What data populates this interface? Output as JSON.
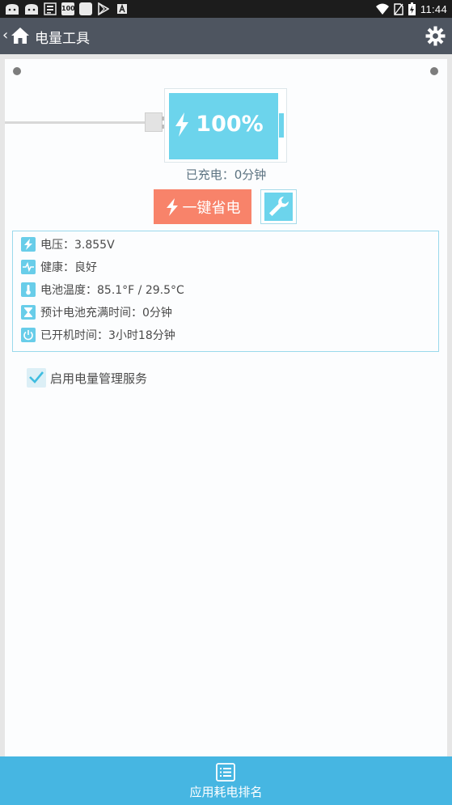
{
  "status_bar": {
    "time": "11:44",
    "icons": [
      "cat-icon",
      "cat-icon",
      "news-icon",
      "100-badge",
      "square-icon",
      "play-store-icon",
      "a-icon"
    ],
    "badge_text": "100",
    "right_icons": [
      "wifi-icon",
      "no-sim-icon",
      "battery-charging-icon"
    ]
  },
  "app_bar": {
    "title": "电量工具",
    "back_icon": "chevron-left-icon",
    "home_icon": "home-icon",
    "settings_icon": "gear-icon"
  },
  "battery": {
    "percent_text": "100%",
    "percent_value": 100,
    "charged_text": "已充电：0分钟"
  },
  "actions": {
    "save_label": "一键省电",
    "tool_icon": "wrench-icon"
  },
  "info": {
    "rows": [
      {
        "icon": "bolt-icon",
        "text": "电压：3.855V"
      },
      {
        "icon": "pulse-icon",
        "text": "健康：良好"
      },
      {
        "icon": "thermometer-icon",
        "text": "电池温度：85.1°F / 29.5°C"
      },
      {
        "icon": "hourglass-icon",
        "text": "预计电池充满时间：0分钟"
      },
      {
        "icon": "power-icon",
        "text": "已开机时间：3小时18分钟"
      }
    ]
  },
  "service": {
    "label": "启用电量管理服务",
    "checked": true
  },
  "bottom_bar": {
    "label": "应用耗电排名",
    "icon": "list-icon"
  },
  "colors": {
    "accent": "#46b6e2",
    "battery": "#6cd4ec",
    "save_button": "#f8836a",
    "app_bar": "#4e5560"
  }
}
